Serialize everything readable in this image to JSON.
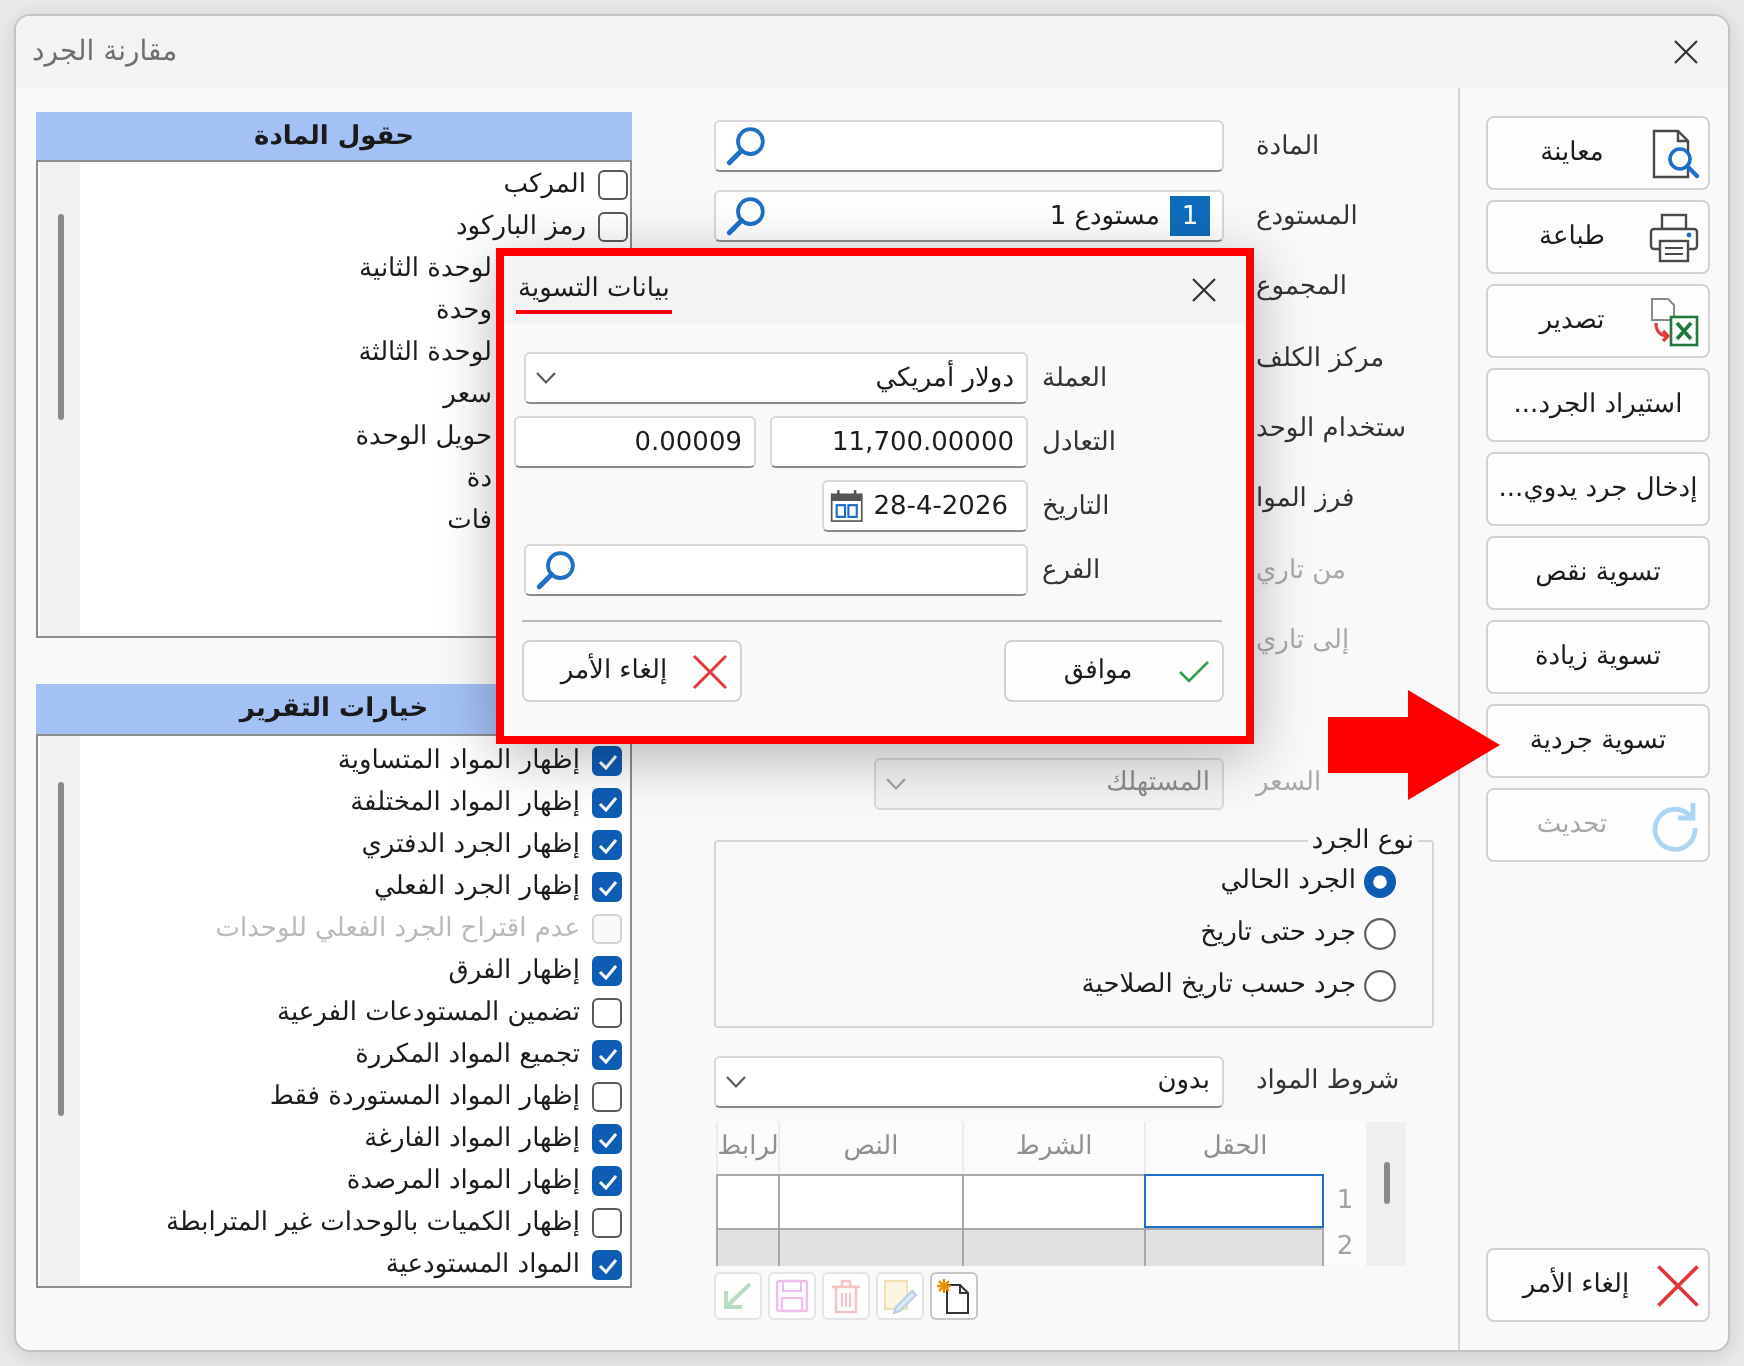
{
  "window": {
    "title": "مقارنة الجرد"
  },
  "item_fields_panel": {
    "title": "حقول المادة",
    "items": [
      {
        "kind": "checkbox",
        "label": "المركب",
        "checked": false
      },
      {
        "kind": "checkbox",
        "label": "رمز الباركود",
        "checked": false
      },
      {
        "kind": "text",
        "label": "لوحدة الثانية"
      },
      {
        "kind": "text",
        "label": "وحدة"
      },
      {
        "kind": "text",
        "label": "لوحدة الثالثة"
      },
      {
        "kind": "text",
        "label": "سعر"
      },
      {
        "kind": "text",
        "label": "حويل الوحدة"
      },
      {
        "kind": "text",
        "label": "دة"
      },
      {
        "kind": "text",
        "label": "فات"
      }
    ]
  },
  "report_options_panel": {
    "title": "خيارات التقرير",
    "items": [
      {
        "label": "إظهار المواد المتساوية",
        "checked": true,
        "disabled": false
      },
      {
        "label": "إظهار المواد المختلفة",
        "checked": true,
        "disabled": false
      },
      {
        "label": "إظهار الجرد الدفتري",
        "checked": true,
        "disabled": false
      },
      {
        "label": "إظهار الجرد الفعلي",
        "checked": true,
        "disabled": false
      },
      {
        "label": "عدم اقتراح الجرد الفعلي للوحدات",
        "checked": false,
        "disabled": true
      },
      {
        "label": "إظهار الفرق",
        "checked": true,
        "disabled": false
      },
      {
        "label": "تضمين المستودعات الفرعية",
        "checked": false,
        "disabled": false
      },
      {
        "label": "تجميع المواد المكررة",
        "checked": true,
        "disabled": false
      },
      {
        "label": "إظهار المواد المستوردة فقط",
        "checked": false,
        "disabled": false
      },
      {
        "label": "إظهار المواد الفارغة",
        "checked": true,
        "disabled": false
      },
      {
        "label": "إظهار المواد المرصدة",
        "checked": true,
        "disabled": false
      },
      {
        "label": "إظهار الكميات بالوحدات غير المترابطة",
        "checked": false,
        "disabled": false
      },
      {
        "label": "المواد المستودعية",
        "checked": true,
        "disabled": false
      }
    ]
  },
  "filters": [
    {
      "kind": "search",
      "label": "المادة",
      "disabled": false
    },
    {
      "kind": "search",
      "label": "المستودع",
      "badge": "1",
      "value": "مستودع 1",
      "disabled": false
    },
    {
      "kind": "label",
      "label": "المجموع",
      "disabled": false
    },
    {
      "kind": "label",
      "label": "مركز الكلف",
      "disabled": false
    },
    {
      "kind": "label",
      "label": "ستخدام الوحد",
      "disabled": false
    },
    {
      "kind": "label",
      "label": "فرز الموا",
      "disabled": false
    },
    {
      "kind": "label",
      "label": "من تاري",
      "disabled": true
    },
    {
      "kind": "label",
      "label": "إلى تاري",
      "disabled": true
    }
  ],
  "price_field": {
    "label": "السعر",
    "value": "المستهلك",
    "disabled": true
  },
  "inventory_type": {
    "legend": "نوع الجرد",
    "options": [
      {
        "label": "الجرد الحالي",
        "selected": true
      },
      {
        "label": "جرد حتى تاريخ",
        "selected": false
      },
      {
        "label": "جرد حسب تاريخ الصلاحية",
        "selected": false
      }
    ]
  },
  "item_conditions": {
    "label": "شروط المواد",
    "value": "بدون"
  },
  "conditions_grid": {
    "disabled": true,
    "columns": [
      "الحقل",
      "الشرط",
      "النص",
      "لرابط"
    ],
    "rows": [
      {
        "number": "1",
        "selected": true
      },
      {
        "number": "2",
        "selected": false
      }
    ]
  },
  "grid_toolbar": [
    {
      "kind": "new",
      "disabled": false
    },
    {
      "kind": "edit",
      "disabled": true
    },
    {
      "kind": "delete",
      "disabled": true
    },
    {
      "kind": "save",
      "disabled": true
    },
    {
      "kind": "undo",
      "disabled": true
    }
  ],
  "side_buttons": [
    {
      "kind": "preview",
      "label": "معاينة",
      "disabled": false
    },
    {
      "kind": "print",
      "label": "طباعة",
      "disabled": false
    },
    {
      "kind": "export",
      "label": "تصدير",
      "disabled": false
    },
    {
      "kind": "text",
      "label": "استيراد الجرد...",
      "disabled": false
    },
    {
      "kind": "text",
      "label": "إدخال جرد يدوي...",
      "disabled": false
    },
    {
      "kind": "text",
      "label": "تسوية نقص",
      "disabled": false
    },
    {
      "kind": "text",
      "label": "تسوية زيادة",
      "disabled": false
    },
    {
      "kind": "text",
      "label": "تسوية جردية",
      "disabled": false
    },
    {
      "kind": "refresh",
      "label": "تحديث",
      "disabled": true
    }
  ],
  "cancel_button": {
    "label": "إلغاء الأمر"
  },
  "settlement_dialog": {
    "tabs": [
      {
        "label": "بيانات التسوية",
        "selected": true
      }
    ],
    "currency": {
      "label": "العملة",
      "value": "دولار أمريكي"
    },
    "rate": {
      "label": "التعادل",
      "values": [
        "11,700.00000",
        "0.00009"
      ]
    },
    "date": {
      "label": "التاريخ",
      "value": "28-4-2026"
    },
    "branch": {
      "label": "الفرع"
    },
    "buttons": [
      {
        "kind": "ok",
        "label": "موافق"
      },
      {
        "kind": "cancel",
        "label": "إلغاء الأمر"
      }
    ]
  }
}
